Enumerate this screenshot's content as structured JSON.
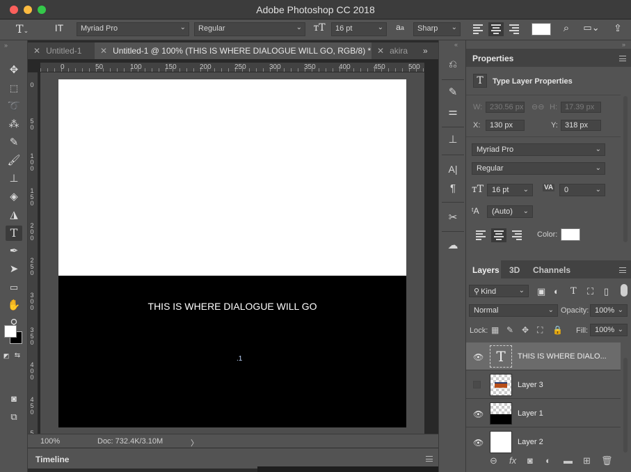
{
  "window": {
    "title": "Adobe Photoshop CC 2018"
  },
  "options_bar": {
    "font_family": "Myriad Pro",
    "font_style": "Regular",
    "font_size": "16 pt",
    "anti_alias_icon_text": "a",
    "anti_alias_icon_sub": "a",
    "anti_alias": "Sharp",
    "text_color": "#ffffff"
  },
  "tabs": [
    {
      "label": "Untitled-1"
    },
    {
      "label": "Untitled-1 @ 100% (THIS IS WHERE DIALOGUE WILL GO, RGB/8) *"
    },
    {
      "label": "akira"
    }
  ],
  "ruler": {
    "h_ticks": [
      "0",
      "50",
      "100",
      "150",
      "200",
      "250",
      "300",
      "350",
      "400",
      "450",
      "500"
    ],
    "v_ticks": [
      [
        "0"
      ],
      [
        "5",
        "0"
      ],
      [
        "1",
        "0",
        "0"
      ],
      [
        "1",
        "5",
        "0"
      ],
      [
        "2",
        "0",
        "0"
      ],
      [
        "2",
        "5",
        "0"
      ],
      [
        "3",
        "0",
        "0"
      ],
      [
        "3",
        "5",
        "0"
      ],
      [
        "4",
        "0",
        "0"
      ],
      [
        "4",
        "5",
        "0"
      ],
      [
        "5"
      ]
    ]
  },
  "canvas": {
    "dialogue_text": "THIS IS WHERE DIALOGUE WILL GO",
    "caret_text": ".1",
    "top_color": "#ffffff",
    "bottom_color": "#000000"
  },
  "status": {
    "zoom": "100%",
    "doc_size": "Doc: 732.4K/3.10M",
    "arrow": "〉"
  },
  "timeline": {
    "label": "Timeline"
  },
  "tools": [
    "move-icon",
    "marquee-icon",
    "lasso-icon",
    "magic-wand-icon",
    "eyedropper-icon",
    "brush-icon",
    "stamp-icon",
    "eraser-icon",
    "paint-bucket-icon",
    "type-icon",
    "pen-icon",
    "path-select-icon",
    "rectangle-icon",
    "hand-icon",
    "zoom-icon",
    "more-icon"
  ],
  "properties": {
    "title": "Properties",
    "subtitle": "Type Layer Properties",
    "w_label": "W:",
    "w_value": "230.56 px",
    "h_label": "H:",
    "h_value": "17.39 px",
    "x_label": "X:",
    "x_value": "130 px",
    "y_label": "Y:",
    "y_value": "318 px",
    "font_family": "Myriad Pro",
    "font_style": "Regular",
    "size": "16 pt",
    "tracking": "0",
    "leading": "(Auto)",
    "color_label": "Color:",
    "color": "#ffffff"
  },
  "layers_panel": {
    "tabs": [
      "Layers",
      "3D",
      "Channels"
    ],
    "kind": "Kind",
    "blend_mode": "Normal",
    "opacity_label": "Opacity:",
    "opacity": "100%",
    "lock_label": "Lock:",
    "fill_label": "Fill:",
    "fill": "100%",
    "layers": [
      {
        "name": "THIS IS WHERE DIALO...",
        "visible": true,
        "selected": true,
        "type": "text"
      },
      {
        "name": "Layer 3",
        "visible": false,
        "selected": false,
        "type": "image"
      },
      {
        "name": "Layer 1",
        "visible": true,
        "selected": false,
        "type": "black-bottom"
      },
      {
        "name": "Layer 2",
        "visible": true,
        "selected": false,
        "type": "white"
      }
    ]
  }
}
